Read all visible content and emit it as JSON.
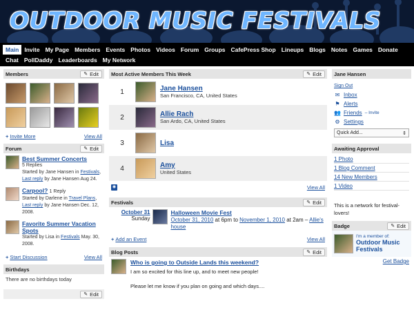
{
  "site": {
    "title": "OUTDOOR MUSIC FESTIVALS"
  },
  "nav": {
    "row1": [
      "Main",
      "Invite",
      "My Page",
      "Members",
      "Events",
      "Photos",
      "Videos",
      "Forum",
      "Groups",
      "CafePress Shop",
      "Lineups",
      "Blogs",
      "Notes",
      "Games",
      "Donate"
    ],
    "row2": [
      "Chat",
      "PollDaddy",
      "Leaderboards",
      "My Network"
    ],
    "active": "Main"
  },
  "members": {
    "header": "Members",
    "edit": "Edit",
    "invite_more": "Invite More",
    "view_all": "View All"
  },
  "forum": {
    "header": "Forum",
    "edit": "Edit",
    "topics": [
      {
        "title": "Best Summer Concerts",
        "replies": "5 Replies",
        "started": "Started by Jane Hansen in",
        "cat": "Festivals",
        "last": "Last reply",
        "tail": "by Jane Hansen Aug 24."
      },
      {
        "title": "Carpool?",
        "replies": "1 Reply",
        "started": "Started by Darlene in",
        "cat": "Travel Plans",
        "last": "Last reply",
        "tail": "by Jane Hansen Dec. 12, 2008."
      },
      {
        "title": "Favorite Summer Vacation Spots",
        "replies": "",
        "started": "Started by Lisa in",
        "cat": "Festivals",
        "last": "",
        "tail": "May. 30, 2008."
      }
    ],
    "start": "Start Discussion",
    "view_all": "View All"
  },
  "birthdays": {
    "header": "Birthdays",
    "text": "There are no birthdays today",
    "edit": "Edit"
  },
  "active_members": {
    "header": "Most Active Members This Week",
    "edit": "Edit",
    "rows": [
      {
        "num": "1",
        "name": "Jane Hansen",
        "loc": "San Francisco, CA, United States"
      },
      {
        "num": "2",
        "name": "Allie Rach",
        "loc": "San Ardo, CA, United States"
      },
      {
        "num": "3",
        "name": "Lisa",
        "loc": ""
      },
      {
        "num": "4",
        "name": "Amy",
        "loc": "United States"
      }
    ],
    "view_all": "View All"
  },
  "festivals": {
    "header": "Festivals",
    "edit": "Edit",
    "event": {
      "date": "October 31",
      "day": "Sunday",
      "title": "Halloween Movie Fest",
      "start": "October 31, 2010",
      "at1": "at 6pm to",
      "end": "November 1, 2010",
      "at2": "at 2am –",
      "host": "Allie's house"
    },
    "add": "Add an Event",
    "view_all": "View All"
  },
  "blog": {
    "header": "Blog Posts",
    "edit": "Edit",
    "title": "Who is going to Outside Lands this weekend?",
    "p1": "I am so excited for this line up, and to meet new people!",
    "p2": "Please let me know if you plan on going and which days...."
  },
  "user": {
    "name": "Jane Hansen",
    "sign_out": "Sign Out",
    "inbox": "Inbox",
    "alerts": "Alerts",
    "friends": "Friends",
    "invite": "– Invite",
    "settings": "Settings",
    "quick_add": "Quick Add..."
  },
  "approval": {
    "header": "Awaiting Approval",
    "items": [
      "1 Photo",
      "1 Blog Comment",
      "14 New Members",
      "1 Video"
    ]
  },
  "about": {
    "text": "This is a network for festival-lovers!"
  },
  "badge": {
    "header": "Badge",
    "edit": "Edit",
    "line1": "I'm a member of:",
    "line2": "Outdoor Music Festivals",
    "get": "Get Badge"
  },
  "colors": {
    "link": "#1a4f9c",
    "banner": "#0b1830",
    "nav": "#000000",
    "header_bg": "#e4e4e4"
  }
}
